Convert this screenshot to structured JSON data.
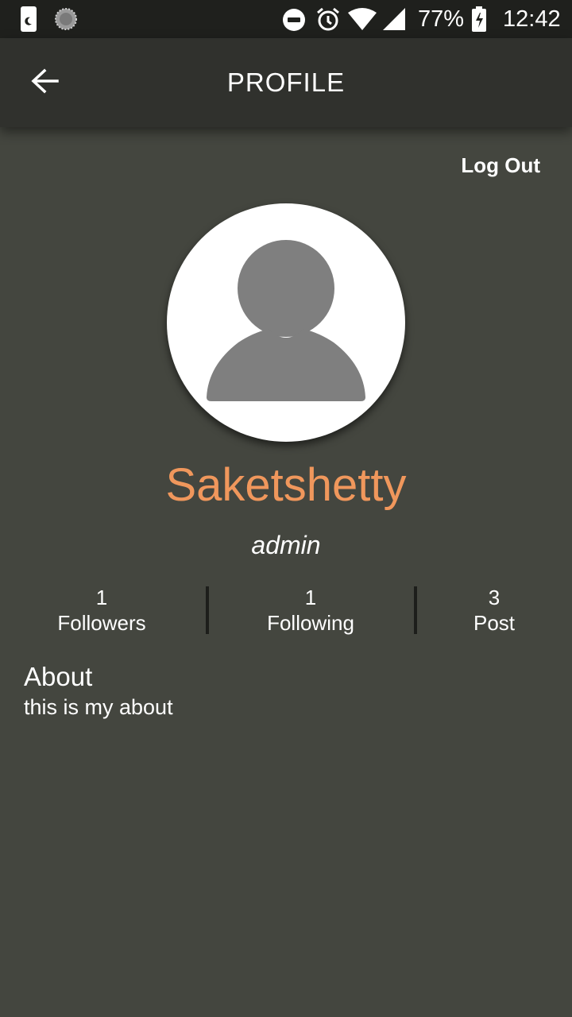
{
  "status_bar": {
    "battery": "77%",
    "time": "12:42",
    "icons": [
      "night-mode-icon",
      "loading-circle-icon",
      "do-not-disturb-icon",
      "alarm-icon",
      "wifi-icon",
      "cellular-signal-icon",
      "battery-charging-icon"
    ]
  },
  "app_bar": {
    "title": "PROFILE",
    "back_icon": "arrow-back-icon"
  },
  "actions": {
    "logout_label": "Log Out"
  },
  "profile": {
    "avatar_icon": "person-placeholder-icon",
    "username": "Saketshetty",
    "role": "admin"
  },
  "stats": [
    {
      "value": "1",
      "label": "Followers"
    },
    {
      "value": "1",
      "label": "Following"
    },
    {
      "value": "3",
      "label": "Post"
    }
  ],
  "about": {
    "title": "About",
    "text": "this is my about"
  },
  "colors": {
    "background": "#44463f",
    "app_bar": "#30312d",
    "status_bar": "#1f201d",
    "username_accent": "#f0975c",
    "avatar_figure": "#7f7f7f"
  }
}
